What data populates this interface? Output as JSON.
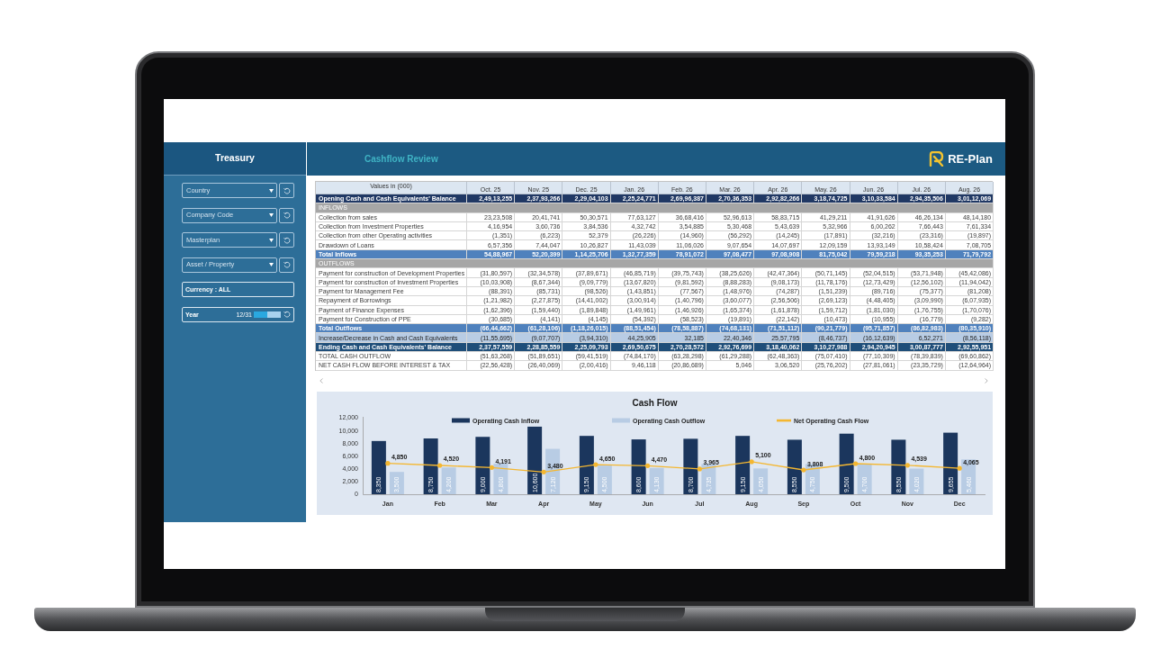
{
  "sidebar": {
    "title": "Treasury",
    "filters": [
      {
        "kind": "dropdown",
        "label": "Country"
      },
      {
        "kind": "dropdown",
        "label": "Company Code"
      },
      {
        "kind": "dropdown",
        "label": "Masterplan"
      },
      {
        "kind": "dropdown",
        "label": "Asset / Property"
      },
      {
        "kind": "text",
        "label": "Currency : ALL"
      },
      {
        "kind": "slider",
        "label": "Year",
        "reading": "12/31",
        "level": 0.5
      }
    ]
  },
  "header": {
    "title": "Cashflow Review",
    "logo_text": "RE-Plan"
  },
  "table": {
    "columns": [
      "Values in (000)",
      "Oct. 25",
      "Nov. 25",
      "Dec. 25",
      "Jan. 26",
      "Feb. 26",
      "Mar. 26",
      "Apr. 26",
      "May. 26",
      "Jun. 26",
      "Jul. 26",
      "Aug. 26"
    ],
    "rows": [
      {
        "kind": "opening",
        "label": "Opening Cash and Cash Equivalents' Balance",
        "values": [
          "2,49,13,255",
          "2,37,93,266",
          "2,29,04,103",
          "2,25,24,771",
          "2,69,96,387",
          "2,70,36,353",
          "2,92,82,266",
          "3,18,74,725",
          "3,10,33,584",
          "2,94,35,506",
          "3,01,12,069"
        ]
      },
      {
        "kind": "section",
        "label": "INFLOWS"
      },
      {
        "kind": "item",
        "label": "Collection from sales",
        "values": [
          "23,23,508",
          "20,41,741",
          "50,30,571",
          "77,63,127",
          "36,68,416",
          "52,96,613",
          "58,83,715",
          "41,29,211",
          "41,91,626",
          "46,26,134",
          "48,14,180"
        ]
      },
      {
        "kind": "item",
        "label": "Collection from Investment Properties",
        "values": [
          "4,16,954",
          "3,60,736",
          "3,84,536",
          "4,32,742",
          "3,54,885",
          "5,30,468",
          "5,43,639",
          "5,32,966",
          "6,00,262",
          "7,66,443",
          "7,61,334"
        ]
      },
      {
        "kind": "item",
        "label": "Collection from other Operating activities",
        "values": [
          "(1,351)",
          "(6,223)",
          "52,379",
          "(26,226)",
          "(14,960)",
          "(56,292)",
          "(14,245)",
          "(17,891)",
          "(32,216)",
          "(23,316)",
          "(19,897)"
        ]
      },
      {
        "kind": "item",
        "label": "Drawdown of Loans",
        "values": [
          "6,57,356",
          "7,44,047",
          "10,26,827",
          "11,43,039",
          "11,06,026",
          "9,07,654",
          "14,07,697",
          "12,09,159",
          "13,93,149",
          "10,58,424",
          "7,08,705"
        ]
      },
      {
        "kind": "total",
        "label": "Total Inflows",
        "values": [
          "54,88,967",
          "52,20,399",
          "1,14,25,706",
          "1,32,77,359",
          "78,91,072",
          "97,08,477",
          "97,08,908",
          "81,75,042",
          "79,59,218",
          "93,35,253",
          "71,79,792"
        ]
      },
      {
        "kind": "section",
        "label": "OUTFLOWS"
      },
      {
        "kind": "item",
        "label": "Payment for construction of Development Properties",
        "values": [
          "(31,80,597)",
          "(32,34,578)",
          "(37,89,671)",
          "(46,85,719)",
          "(39,75,743)",
          "(38,25,626)",
          "(42,47,364)",
          "(50,71,145)",
          "(52,04,515)",
          "(53,71,948)",
          "(45,42,086)"
        ]
      },
      {
        "kind": "item",
        "label": "Payment for construction of Investment Properties",
        "values": [
          "(10,03,908)",
          "(8,67,344)",
          "(9,09,779)",
          "(13,67,820)",
          "(9,81,592)",
          "(8,88,283)",
          "(9,08,173)",
          "(11,78,176)",
          "(12,73,429)",
          "(12,56,102)",
          "(11,94,042)"
        ]
      },
      {
        "kind": "item",
        "label": "Payment for Management Fee",
        "values": [
          "(88,391)",
          "(85,731)",
          "(98,526)",
          "(1,43,851)",
          "(77,567)",
          "(1,48,976)",
          "(74,287)",
          "(1,51,239)",
          "(89,716)",
          "(75,377)",
          "(81,208)"
        ]
      },
      {
        "kind": "item",
        "label": "Repayment of Borrowings",
        "values": [
          "(1,21,982)",
          "(2,27,875)",
          "(14,41,002)",
          "(3,00,914)",
          "(1,40,796)",
          "(3,60,077)",
          "(2,56,506)",
          "(2,69,123)",
          "(4,48,405)",
          "(3,09,990)",
          "(6,07,935)"
        ]
      },
      {
        "kind": "item",
        "label": "Payment of Finance Expenses",
        "values": [
          "(1,62,396)",
          "(1,59,440)",
          "(1,89,848)",
          "(1,49,961)",
          "(1,46,926)",
          "(1,65,374)",
          "(1,61,878)",
          "(1,59,712)",
          "(1,81,030)",
          "(1,76,755)",
          "(1,70,076)"
        ]
      },
      {
        "kind": "item",
        "label": "Payment for Construction of PPE",
        "values": [
          "(30,685)",
          "(4,141)",
          "(4,145)",
          "(54,392)",
          "(58,523)",
          "(19,891)",
          "(22,142)",
          "(10,473)",
          "(10,955)",
          "(16,779)",
          "(9,282)"
        ]
      },
      {
        "kind": "total",
        "label": "Total Outflows",
        "values": [
          "(66,44,662)",
          "(61,28,106)",
          "(1,18,26,015)",
          "(88,51,454)",
          "(78,58,887)",
          "(74,68,131)",
          "(71,51,112)",
          "(90,21,779)",
          "(95,71,857)",
          "(86,82,983)",
          "(80,35,910)"
        ]
      },
      {
        "kind": "change",
        "label": "Increase/Decrease in Cash and Cash Equivalents",
        "values": [
          "(11,55,695)",
          "(9,07,707)",
          "(3,94,310)",
          "44,25,905",
          "32,185",
          "22,40,346",
          "25,57,795",
          "(8,46,737)",
          "(16,12,639)",
          "6,52,271",
          "(8,56,118)"
        ]
      },
      {
        "kind": "ending",
        "label": "Ending Cash and Cash Equivalents' Balance",
        "values": [
          "2,37,57,559",
          "2,28,85,559",
          "2,25,09,793",
          "2,69,50,675",
          "2,70,28,572",
          "2,92,76,699",
          "3,18,40,062",
          "3,10,27,988",
          "2,94,20,945",
          "3,00,87,777",
          "2,92,55,951"
        ]
      },
      {
        "kind": "item",
        "label": "TOTAL CASH OUTFLOW",
        "values": [
          "(51,63,268)",
          "(51,89,651)",
          "(59,41,519)",
          "(74,84,170)",
          "(63,28,298)",
          "(61,29,288)",
          "(62,48,363)",
          "(75,07,410)",
          "(77,10,309)",
          "(78,39,839)",
          "(69,60,862)"
        ]
      },
      {
        "kind": "item",
        "label": "NET CASH FLOW BEFORE INTEREST & TAX",
        "values": [
          "(22,56,428)",
          "(26,40,069)",
          "(2,00,416)",
          "9,46,118",
          "(20,86,689)",
          "5,046",
          "3,06,520",
          "(25,76,202)",
          "(27,81,061)",
          "(23,35,729)",
          "(12,64,964)"
        ]
      }
    ]
  },
  "chart": {
    "chart_data": {
      "type": "bar",
      "title": "Cash Flow",
      "categories": [
        "Jan",
        "Feb",
        "Mar",
        "Apr",
        "May",
        "Jun",
        "Jul",
        "Aug",
        "Sep",
        "Oct",
        "Nov",
        "Dec"
      ],
      "series": [
        {
          "name": "Operating Cash Inflow",
          "type": "bar",
          "color": "#1b365d",
          "values": [
            8350,
            8750,
            9000,
            10600,
            9150,
            8600,
            8700,
            9150,
            8550,
            9500,
            8550,
            9655
          ],
          "value_labels": [
            "8,350",
            "8,750",
            "9,000",
            "10,600",
            "9,150",
            "8,600",
            "8,700",
            "9,150",
            "8,550",
            "9,500",
            "8,550",
            "9,655"
          ]
        },
        {
          "name": "Operating Cash Outflow",
          "type": "bar",
          "color": "#b8cce4",
          "values": [
            3500,
            4200,
            4800,
            7120,
            4500,
            4130,
            4735,
            4050,
            4750,
            4700,
            4020,
            5460
          ],
          "value_labels": [
            "3,500",
            "4,200",
            "4,800",
            "7,120",
            "4,500",
            "4,130",
            "4,735",
            "4,050",
            "4,750",
            "4,700",
            "4,020",
            "5,460"
          ]
        },
        {
          "name": "Net Operating Cash Flow",
          "type": "line",
          "color": "#f4b731",
          "values": [
            4850,
            4520,
            4191,
            3480,
            4650,
            4470,
            3965,
            5100,
            3808,
            4800,
            4539,
            4065
          ],
          "value_labels": [
            "4,850",
            "4,520",
            "4,191",
            "3,480",
            "4,650",
            "4,470",
            "3,965",
            "5,100",
            "3,808",
            "4,800",
            "4,539",
            "4,065"
          ]
        }
      ],
      "legend": true,
      "stacked": false,
      "ylim": [
        0,
        12000
      ],
      "yticks": [
        0,
        {
          "value": 2000,
          "label": "2,000"
        },
        {
          "value": 4000,
          "label": "4,000"
        },
        {
          "value": 6000,
          "label": "6,000"
        },
        {
          "value": 8000,
          "label": "8,000"
        },
        {
          "value": 10000,
          "label": "10,000"
        },
        {
          "value": 12000,
          "label": "12,000"
        }
      ]
    }
  }
}
